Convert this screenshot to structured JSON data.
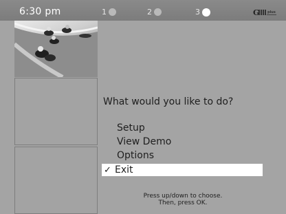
{
  "header": {
    "time": "6:30 pm",
    "steps": [
      {
        "label": "1",
        "active": false
      },
      {
        "label": "2",
        "active": false
      },
      {
        "label": "3",
        "active": true
      }
    ],
    "brand": "Guide Plus+"
  },
  "thumbnails": {
    "photo_icon": "motorcycle-race-photo"
  },
  "prompt": {
    "question": "What would you like to do?"
  },
  "menu": {
    "items": [
      {
        "label": "Setup",
        "selected": false
      },
      {
        "label": "View Demo",
        "selected": false
      },
      {
        "label": "Options",
        "selected": false
      },
      {
        "label": "Exit",
        "selected": true
      }
    ],
    "check_glyph": "✓"
  },
  "help": {
    "line1": "Press up/down to choose.",
    "line2": "Then, press OK."
  },
  "colors": {
    "background": "#a4a4a4",
    "topbar": "#808080",
    "selection": "#ffffff"
  }
}
